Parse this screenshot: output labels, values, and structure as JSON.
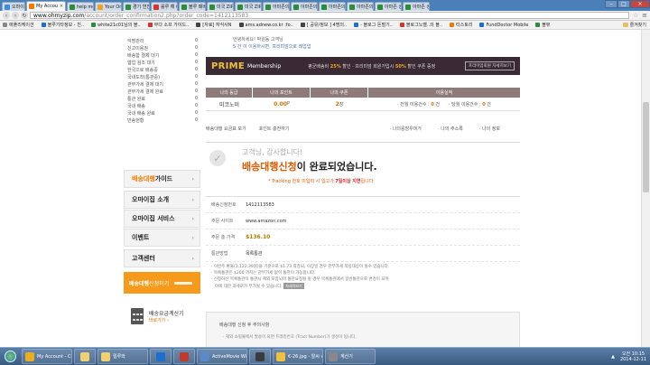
{
  "browser": {
    "tabs": [
      {
        "label": "오마이집",
        "color": "#3b8de0",
        "active": false,
        "w": 26
      },
      {
        "label": "My Accou",
        "color": "#f07b00",
        "active": true,
        "w": 44
      },
      {
        "label": "help me",
        "color": "#2a8d3a",
        "active": false,
        "w": 30
      },
      {
        "label": "Your Ord",
        "color": "#f0a020",
        "active": false,
        "w": 30
      },
      {
        "label": "경기 연진",
        "color": "#2a8d3a",
        "active": false,
        "w": 30
      },
      {
        "label": "롤루 해 0",
        "color": "#d9342b",
        "active": false,
        "w": 30
      },
      {
        "label": "블루 패버",
        "color": "#2a8d3a",
        "active": false,
        "w": 30
      },
      {
        "label": "미국 ZIP",
        "color": "#2a8d3a",
        "active": false,
        "w": 30
      },
      {
        "label": "미국 ZIP",
        "color": "#2a8d3a",
        "active": false,
        "w": 30
      },
      {
        "label": "아마존의",
        "color": "#2a8d3a",
        "active": false,
        "w": 30
      },
      {
        "label": "아마존의",
        "color": "#2a8d3a",
        "active": false,
        "w": 30
      },
      {
        "label": "아마존의",
        "color": "#2a8d3a",
        "active": false,
        "w": 30
      },
      {
        "label": "아마존의",
        "color": "#2a8d3a",
        "active": false,
        "w": 30
      },
      {
        "label": "아마존 싱",
        "color": "#2a8d3a",
        "active": false,
        "w": 30
      },
      {
        "label": "아마존 싱",
        "color": "#2a8d3a",
        "active": false,
        "w": 30
      }
    ],
    "url_host": "www.ohmyzip.com",
    "url_path": "/account/order_confirmation2.php?order_code=1412113583",
    "bookmarks": [
      {
        "label": "애플리케이션",
        "color": "#888"
      },
      {
        "label": "블루기타정보 - 친..",
        "color": "#1a6fd1"
      },
      {
        "label": "white21c01님의 블..",
        "color": "#2a8d3a"
      },
      {
        "label": "부다 소프 가이드..",
        "color": "#d9342b"
      },
      {
        "label": "[자료] 자식사N",
        "color": "#444"
      },
      {
        "label": "ams.adnew.co.kr :fo..",
        "color": "#444"
      },
      {
        "label": "[ 공유/정보 ] 4명의..",
        "color": "#444"
      },
      {
        "label": "- 블로그 돈벌기..",
        "color": "#1a6fd1"
      },
      {
        "label": "블로그노벨..의 블..",
        "color": "#d9342b"
      },
      {
        "label": "티스토리",
        "color": "#f07b00"
      },
      {
        "label": "FundDoctor Mobile",
        "color": "#1a6fd1"
      },
      {
        "label": "블뷰",
        "color": "#2a8d3a"
      }
    ],
    "bookmarks_other": "즐겨찾기"
  },
  "sidebar": {
    "links": [
      {
        "label": "익명관리",
        "count": "0"
      },
      {
        "label": "신고이용권",
        "count": "0"
      },
      {
        "label": "배송함 결제 대기",
        "count": "0"
      },
      {
        "label": "웹업 검조 대기",
        "count": "0"
      },
      {
        "label": "한국으로 배송중",
        "count": "0"
      },
      {
        "label": "국내도착(통관중)",
        "count": "0"
      },
      {
        "label": "관부가세 결제 대기",
        "count": "0"
      },
      {
        "label": "관부가세 결제 완료",
        "count": "0"
      },
      {
        "label": "통관 완료",
        "count": "0"
      },
      {
        "label": "국내 배송",
        "count": "0"
      },
      {
        "label": "국내 배송 완료",
        "count": "0"
      },
      {
        "label": "반송현황",
        "count": "0"
      }
    ],
    "guide_hl": "배송대행",
    "guide_rest": " 가이드",
    "menu": [
      "오마이집 소개",
      "오마이집 서비스",
      "이벤트",
      "고객센터"
    ],
    "apply_hl": "배송대행",
    "apply_rest": " 신청하기",
    "calc_title": "배송요금계산기",
    "calc_sub": "바로가기 ›"
  },
  "main": {
    "greet1": "안녕하세요! 박원동 고객님",
    "greet2": "5 건 이 이용하시면, 프리미엄으로 레업업",
    "prime": {
      "title": "PRIME",
      "membership": "Membership",
      "desc1": "평균배송비 ",
      "pct1": "25%",
      "desc2": " 할인 · 프리미엄 회원가입시 ",
      "pct2": "50%",
      "desc3": " 할인 쿠폰 증정",
      "button": "프리미엄회원 자세히보기"
    },
    "headers": [
      "나의 등급",
      "나의 포인트",
      "나의 쿠폰",
      "이용실적"
    ],
    "values": {
      "grade": "미코노미",
      "point_num": "0.00",
      "point_unit": " P",
      "coupon_num": "2",
      "coupon_unit": " 장",
      "usage1": "· 전월 이용건수 : ",
      "usage1_num": "0",
      "usage1_unit": " 건",
      "usage2": "· 당월 이용건수 : ",
      "usage2_num": "0",
      "usage2_unit": " 건"
    },
    "links": [
      "배송대행 요금표 보기",
      "포인트 충전하기"
    ],
    "links_right": [
      "· 나의응장우미가",
      "· 나의 주소록",
      "· 나의 정보"
    ],
    "done_thanks": "고객님, 감사합니다!",
    "done_hl": "배송대행신청",
    "done_rest": "이 완료되었습니다.",
    "notice_pre": "* Tracking 번호 미입력 시 입고가 ",
    "notice_bold": "7일이상 지연",
    "notice_post": "됩니다.",
    "info": [
      {
        "label": "배송신청번호",
        "value": "1412113583",
        "price": false
      },
      {
        "label": "주문 사이트",
        "value": "www.amazon.com",
        "price": false
      },
      {
        "label": "주문 총 가격",
        "value": "$136.10",
        "price": true
      },
      {
        "label": "통관방법",
        "value": "목록통관",
        "price": false
      }
    ],
    "foot1": "· 이번주 환율(1,122.39원)을 기준으로 $1.73 최종되, 이상일 경우 관부가세 적용대상이 될수 있습니다.",
    "foot2": "· 목록통관은 $200 까지는 관부가세 없이 통관이 가능합니다.",
    "foot3": "· 신청하신 목록통관이 통관시 제외 포함되어 통관요청될 될 경우 목록통관에서 일반통관으로 변경이 되며",
    "foot4": "이에 대한 과세로가 부가될 수 있습니다.",
    "foot_btn": "자세히보기",
    "fbox_title": "배송대행 신청 후 주의사항",
    "fbox_sub": "· 해외 쇼핑몰에서 발송이 되면 트래킹번호 (Tract Number)가 생성이 됩니다."
  },
  "taskbar": {
    "items": [
      {
        "label": "My Account - Ch..",
        "color": "#e8b020",
        "sq": false
      },
      {
        "label": "",
        "color": "#f0d070",
        "sq": true
      },
      {
        "label": "릴루와",
        "color": "#f0d070",
        "sq": false
      },
      {
        "label": "",
        "color": "#1a6fd1",
        "sq": true
      },
      {
        "label": "",
        "color": "#c0392b",
        "sq": true
      },
      {
        "label": "ActiveMovie Win..",
        "color": "#5b8ac9",
        "sq": false
      },
      {
        "label": "",
        "color": "#3b3b3b",
        "sq": true
      },
      {
        "label": "€-26.jpg - 알씨 v..",
        "color": "#f0c040",
        "sq": false
      },
      {
        "label": "계산기",
        "color": "#888",
        "sq": false
      }
    ],
    "time": "오전 10:15",
    "date": "2014-12-11"
  }
}
